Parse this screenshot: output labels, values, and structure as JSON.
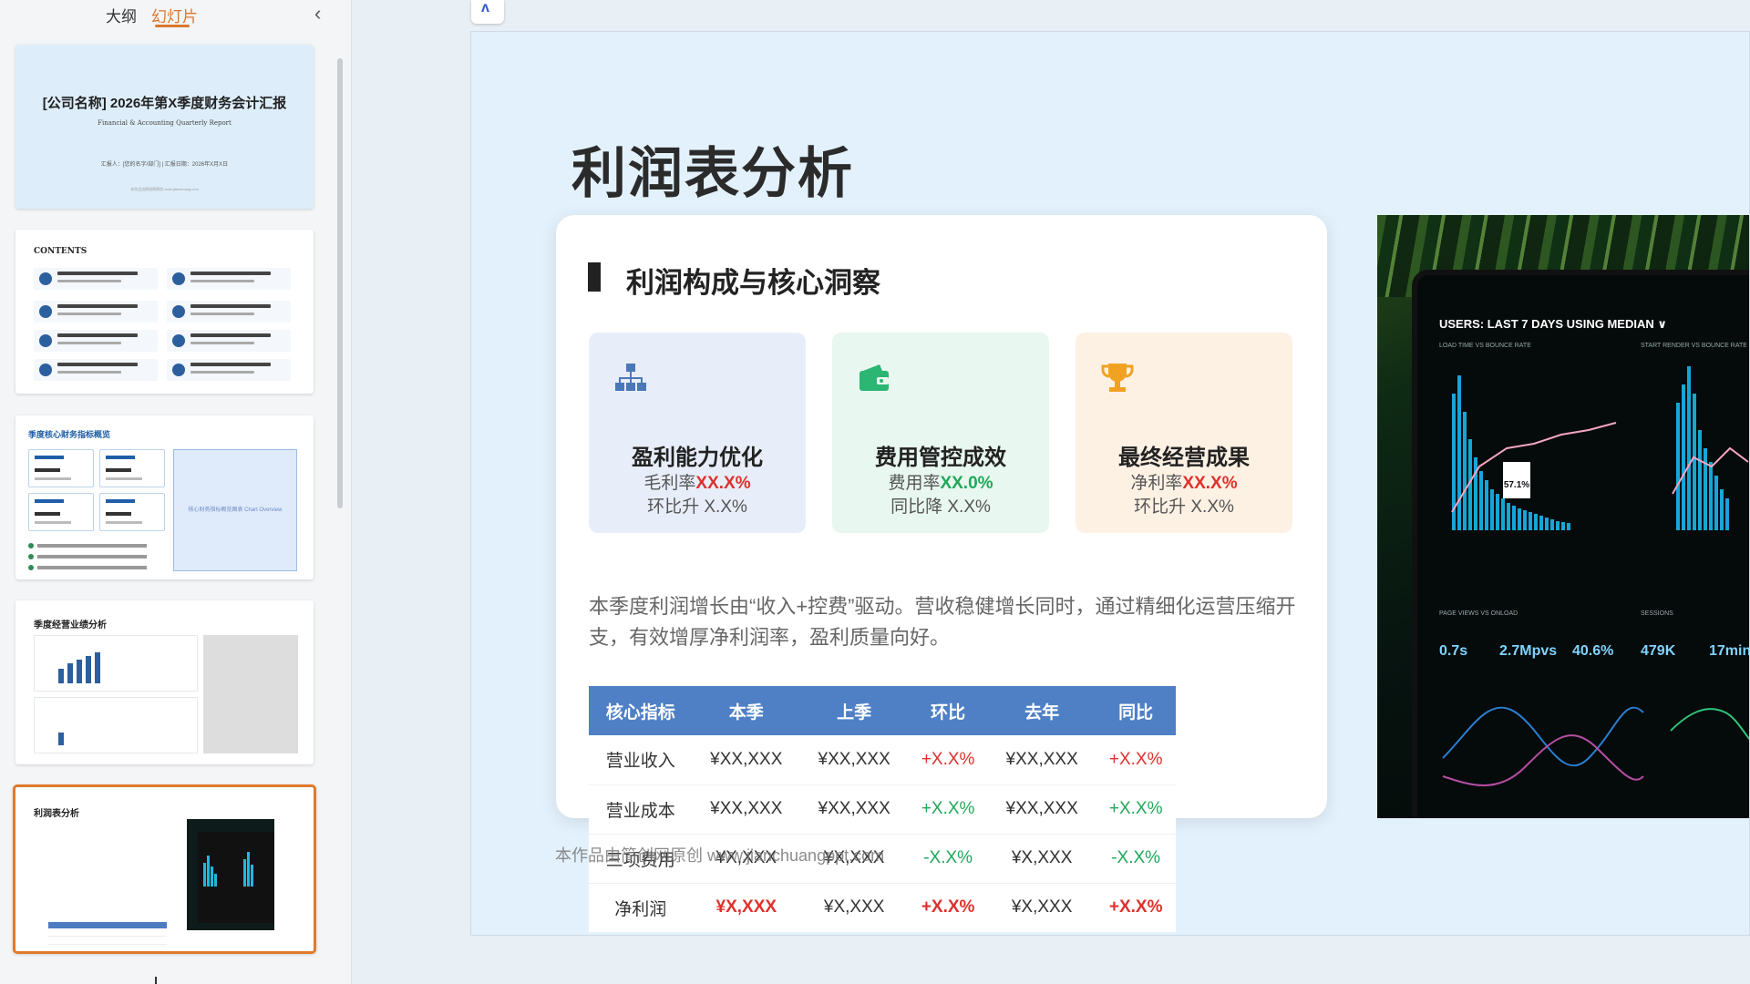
{
  "panel": {
    "tab_outline": "大纲",
    "tab_slides": "幻灯片",
    "collapse_icon": "chevron-left-icon"
  },
  "thumbnails": {
    "t1": {
      "title": "[公司名称] 2026年第X季度财务会计汇报",
      "subtitle": "Financial & Accounting Quarterly Report",
      "meta": "汇报人：[您的名字/部门] | 汇报日期：2026年X月X日",
      "footer": "本作品由简创网原创 www.jianchuang.com"
    },
    "t2": {
      "title": "CONTENTS"
    },
    "t3": {
      "title": "季度核心财务指标概览",
      "box": "核心财务指标概览图表 Chart Overview"
    },
    "t4": {
      "title": "季度经营业绩分析"
    },
    "t5": {
      "title": "利润表分析"
    }
  },
  "app": {
    "logo_glyph": "ʌ"
  },
  "slide": {
    "title": "利润表分析",
    "section_title": "利润构成与核心洞察",
    "cards": [
      {
        "icon": "org-chart-icon",
        "title": "盈利能力优化",
        "label": "毛利率",
        "value": "XX.X%",
        "sub": "环比升 X.X%",
        "accent": "#e0302c"
      },
      {
        "icon": "wallet-icon",
        "title": "费用管控成效",
        "label": "费用率",
        "value": "XX.0%",
        "sub": "同比降 X.X%",
        "accent": "#1fa85a"
      },
      {
        "icon": "trophy-icon",
        "title": "最终经营成果",
        "label": "净利率",
        "value": "XX.X%",
        "sub": "环比升 X.X%",
        "accent": "#e0302c"
      }
    ],
    "description": "本季度利润增长由“收入+控费”驱动。营收稳健增长同时，通过精细化运营压缩开支，有效增厚净利润率，盈利质量向好。",
    "table": {
      "headers": [
        "核心指标",
        "本季",
        "上季",
        "环比",
        "去年",
        "同比"
      ],
      "rows": [
        [
          "营业收入",
          "¥XX,XXX",
          "¥XX,XXX",
          "+X.X%",
          "¥XX,XXX",
          "+X.X%"
        ],
        [
          "营业成本",
          "¥XX,XXX",
          "¥XX,XXX",
          "+X.X%",
          "¥XX,XXX",
          "+X.X%"
        ],
        [
          "三项费用",
          "¥X,XXX",
          "¥X,XXX",
          "-X.X%",
          "¥X,XXX",
          "-X.X%"
        ],
        [
          "净利润",
          "¥X,XXX",
          "¥X,XXX",
          "+X.X%",
          "¥X,XXX",
          "+X.X%"
        ]
      ]
    },
    "watermark": "本作品由简创网原创 www.jianchuangppt.com",
    "photo": {
      "heading": "USERS: LAST 7 DAYS USING MEDIAN ∨",
      "sub_left": "LOAD TIME VS BOUNCE RATE",
      "sub_right": "START RENDER VS BOUNCE RATE",
      "tag": "57.1%",
      "stats": [
        "0.7s",
        "2.7Mpvs",
        "40.6%",
        "479K",
        "17min"
      ],
      "bottom_label": "PAGE VIEWS VS ONLOAD",
      "sessions_label": "SESSIONS"
    }
  },
  "colors": {
    "accent_orange": "#e07a2c",
    "table_header": "#4f80c6",
    "red": "#e0302c",
    "green": "#1fa85a"
  }
}
